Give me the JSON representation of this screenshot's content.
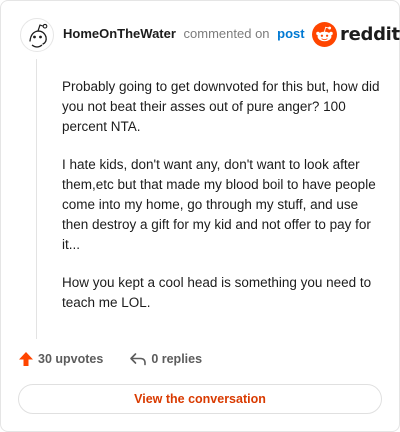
{
  "header": {
    "author": "HomeOnTheWater",
    "action": "commented on",
    "post_link": "post",
    "brand": "reddit"
  },
  "comment": {
    "paragraphs": [
      "Probably going to get downvoted for this but, how did you not beat their asses out of pure anger? 100 percent NTA.",
      "I hate kids, don't want any, don't want to look after them,etc but that made my blood boil to have people come into my home, go through my stuff, and use then destroy a gift for my kid and not offer to pay for it...",
      "How you kept a cool head is something you need to teach me LOL."
    ]
  },
  "footer": {
    "upvotes": "30 upvotes",
    "replies": "0 replies"
  },
  "cta": {
    "label": "View the conversation"
  },
  "icons": {
    "avatar": "snoo-avatar-icon",
    "brand": "reddit-logo-icon",
    "upvote": "upvote-arrow-icon",
    "reply": "reply-arrow-icon"
  },
  "colors": {
    "brand": "#ff4500",
    "link": "#0079d3",
    "cta_text": "#d93a00",
    "upvote": "#ff4500"
  }
}
